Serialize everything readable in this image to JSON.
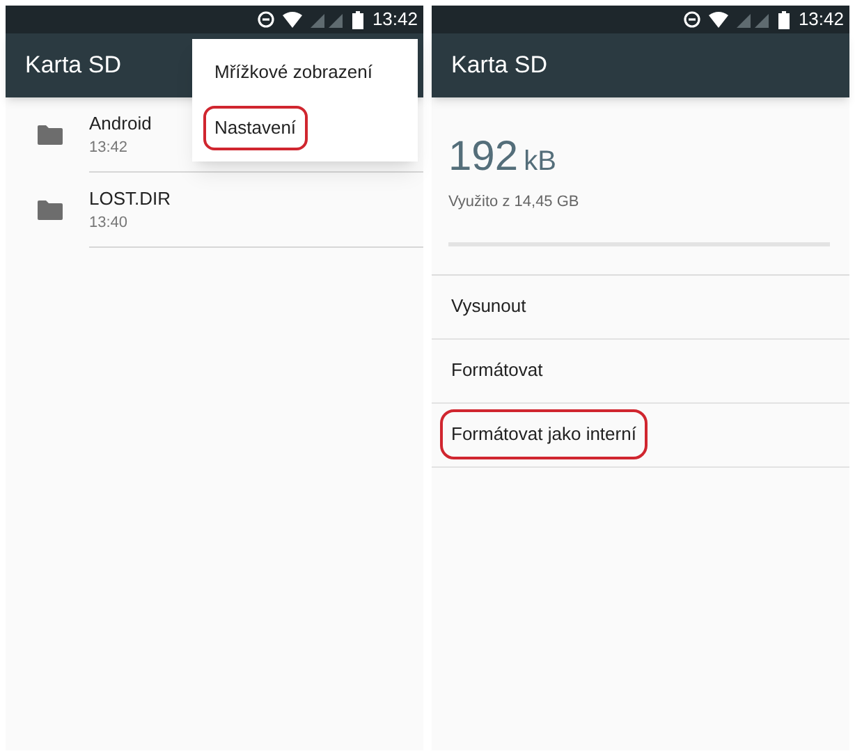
{
  "left_screen": {
    "status_bar": {
      "time": "13:42"
    },
    "toolbar": {
      "title": "Karta SD"
    },
    "files": [
      {
        "name": "Android",
        "time": "13:42"
      },
      {
        "name": "LOST.DIR",
        "time": "13:40"
      }
    ],
    "menu": [
      {
        "label": "Mřížkové zobrazení",
        "highlighted": false
      },
      {
        "label": "Nastavení",
        "highlighted": true
      }
    ]
  },
  "right_screen": {
    "status_bar": {
      "time": "13:42"
    },
    "toolbar": {
      "title": "Karta SD"
    },
    "storage": {
      "used_value": "192",
      "used_unit": "kB",
      "caption": "Využito z 14,45 GB"
    },
    "actions": [
      {
        "label": "Vysunout",
        "highlighted": false
      },
      {
        "label": "Formátovat",
        "highlighted": false
      },
      {
        "label": "Formátovat jako interní",
        "highlighted": true
      }
    ]
  }
}
